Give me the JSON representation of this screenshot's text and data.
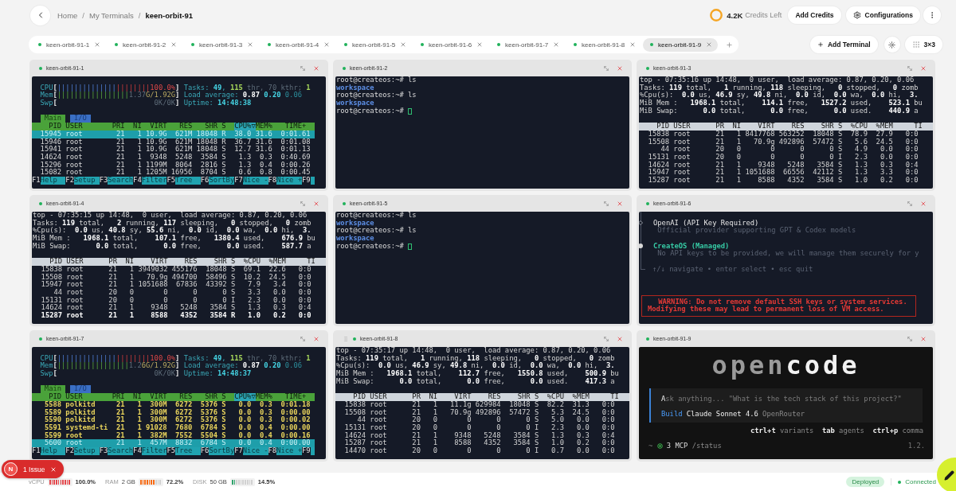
{
  "header": {
    "breadcrumb": {
      "items": [
        "Home",
        "My Terminals",
        "keen-orbit-91"
      ],
      "separator": "/"
    },
    "credits": {
      "amount": "4.2K",
      "label": "Credits Left"
    },
    "add_credits": "Add Credits",
    "configurations": "Configurations"
  },
  "tabs": [
    {
      "label": "keen-orbit-91-1",
      "selected": false
    },
    {
      "label": "keen-orbit-91-2",
      "selected": false
    },
    {
      "label": "keen-orbit-91-3",
      "selected": false
    },
    {
      "label": "keen-orbit-91-4",
      "selected": false
    },
    {
      "label": "keen-orbit-91-5",
      "selected": false
    },
    {
      "label": "keen-orbit-91-6",
      "selected": false
    },
    {
      "label": "keen-orbit-91-7",
      "selected": false
    },
    {
      "label": "keen-orbit-91-8",
      "selected": false
    },
    {
      "label": "keen-orbit-91-9",
      "selected": true
    }
  ],
  "toolbar": {
    "add_terminal": "Add Terminal",
    "layout": "3×3"
  },
  "terminals": [
    {
      "title": "keen-orbit-91-1",
      "kind": "htop",
      "hovered": false,
      "meters": [
        [
          {
            "kind": "label",
            "text": "CPU"
          },
          {
            "kind": "bracket",
            "text": "["
          },
          {
            "kind": "bar-blue",
            "text": "||||||||||||||"
          },
          {
            "kind": "bar-red",
            "text": "||||||||"
          },
          {
            "kind": "red",
            "text": "100.0%"
          },
          {
            "kind": "bracket",
            "text": "]"
          },
          {
            "kind": "label",
            "text": " Tasks: "
          },
          {
            "kind": "cyan-bold",
            "text": "49"
          },
          {
            "kind": "label",
            "text": ", "
          },
          {
            "kind": "green-bold",
            "text": "115"
          },
          {
            "kind": "dim",
            "text": " thr, 70 kthr; "
          },
          {
            "kind": "green-bold",
            "text": "1"
          }
        ],
        [
          {
            "kind": "label",
            "text": "Mem"
          },
          {
            "kind": "bracket",
            "text": "["
          },
          {
            "kind": "bar-green",
            "text": "|||||||||||||||||"
          },
          {
            "kind": "dim",
            "text": "1.37"
          },
          {
            "kind": "yellow",
            "text": "G/1.92G"
          },
          {
            "kind": "bracket",
            "text": "]"
          },
          {
            "kind": "label",
            "text": " Load average: "
          },
          {
            "kind": "white-bold",
            "text": "0.87"
          },
          {
            "kind": "cyan-bold",
            "text": " 0.20"
          },
          {
            "kind": "cyan-dim",
            "text": " 0.06"
          }
        ],
        [
          {
            "kind": "label",
            "text": "Swp"
          },
          {
            "kind": "bracket",
            "text": "["
          },
          {
            "kind": "dim",
            "text": "                       0K/0K"
          },
          {
            "kind": "bracket",
            "text": "]"
          },
          {
            "kind": "label",
            "text": " Uptime: "
          },
          {
            "kind": "cyan-bold",
            "text": "14:48:38"
          }
        ]
      ],
      "tabs": [
        {
          "label": "Main",
          "selected": true
        },
        {
          "label": "I/O",
          "selected": false
        }
      ],
      "columns": [
        {
          "text": "    PID USER       PRI  NI  VIRT   RES   SHR S  ",
          "selected": false
        },
        {
          "text": "CPU%▽",
          "selected": true
        },
        {
          "text": "MEM%   TIME+",
          "selected": false
        }
      ],
      "processes": [
        {
          "text": "  15945 root        21   1 10.9G  621M 18048 R  38.0 31.6  0:01.61",
          "selected": true,
          "marked": false
        },
        {
          "text": "  15946 root        21   1 10.9G  621M 18048 R  36.7 31.6  0:01.08",
          "selected": false,
          "marked": false
        },
        {
          "text": "  15941 root        21   1 10.9G  621M 18048 S  12.7 31.6  0:01.13",
          "selected": false,
          "marked": false
        },
        {
          "text": "  14624 root        21   1  9348  5248  3584 S   1.3  0.3  0:40.69",
          "selected": false,
          "marked": false
        },
        {
          "text": "  15296 root        21   1 1199M  8064  2816 S   1.3  0.4  0:00.26",
          "selected": false,
          "marked": false
        },
        {
          "text": "  15082 root        21   1 1205M 16956  8704 S   0.6  0.8  0:00.45",
          "selected": false,
          "marked": false
        }
      ],
      "function_keys": [
        {
          "key": "F1",
          "label": "Help"
        },
        {
          "key": "F2",
          "label": "Setup"
        },
        {
          "key": "F3",
          "label": "Search"
        },
        {
          "key": "F4",
          "label": "Filter"
        },
        {
          "key": "F5",
          "label": "Tree"
        },
        {
          "key": "F6",
          "label": "SortBy"
        },
        {
          "key": "F7",
          "label": "Nice -"
        },
        {
          "key": "F8",
          "label": "Nice +"
        },
        {
          "key": "F9"
        }
      ]
    },
    {
      "title": "keen-orbit-91-2",
      "kind": "shell",
      "hovered": false,
      "lines": [
        {
          "kind": "command",
          "text": "root@createos:~# ls"
        },
        {
          "kind": "output",
          "text": "workspace"
        },
        {
          "kind": "command",
          "text": "root@createos:~# ls"
        },
        {
          "kind": "output",
          "text": "workspace"
        },
        {
          "kind": "prompt",
          "text": "root@createos:~#"
        }
      ]
    },
    {
      "title": "keen-orbit-91-3",
      "kind": "top",
      "hovered": false,
      "summary": [
        "top - 07:35:16 up 14:48,  0 user,  load average: 0.87, 0.20, 0.06",
        "Tasks: **119** total,   **1** running, **118** sleeping,   **0** stopped,   **0** zomb",
        "%Cpu(s):  **0.0** us, **46.9** sy, **49.8** ni,  **0.0** id,  **0.0** wa,  **0.0** hi,  **3.**",
        "MiB Mem :   **1968.1** total,    **114.1** free,   **1527.2** used,    **523.1** bu",
        "MiB Swap:      **0.0** total,      **0.0** free,      **0.0** used.    **440.9** a"
      ],
      "columns": "    PID USER      PR  NI    VIRT    RES    SHR S  %CPU  %MEM     TI",
      "processes": [
        {
          "text": "  15838 root      21   1 8417768 563252  18048 S  78.9  27.9   0:0",
          "highlighted": false
        },
        {
          "text": "  15508 root      21   1   70.9g 492896  57472 S   5.6  24.5   0:0",
          "highlighted": false
        },
        {
          "text": "     44 root      20   0       0      0      0 S   4.9   0.0   0:0",
          "highlighted": false
        },
        {
          "text": "  15131 root      20   0       0      0      0 I   2.3   0.0   0:0",
          "highlighted": false
        },
        {
          "text": "  14624 root      21   1    9348   5248   3584 S   1.3   0.3   0:4",
          "highlighted": false
        },
        {
          "text": "  15947 root      21   1 1051688  66556  42112 S   1.3   3.3   0:0",
          "highlighted": false
        },
        {
          "text": "  15287 root      21   1    8588   4352   3584 S   1.0   0.2   0:0",
          "highlighted": false
        }
      ]
    },
    {
      "title": "keen-orbit-91-4",
      "kind": "top",
      "hovered": false,
      "summary": [
        "top - 07:35:15 up 14:48,  0 user,  load average: 0.87, 0.20, 0.06",
        "Tasks: **119** total,   **2** running, **117** sleeping,   **0** stopped,   **0** zomb",
        "%Cpu(s):  **0.0** us, **40.8** sy, **55.6** ni,  **0.0** id,  **0.0** wa,  **0.0** hi,  **3.**",
        "MiB Mem :   **1968.1** total,    **107.1** free,   **1380.4** used,    **676.9** bu",
        "MiB Swap:      **0.0** total,      **0.0** free,      **0.0** used.    **587.7** a"
      ],
      "columns": "    PID USER      PR  NI    VIRT    RES    SHR S  %CPU  %MEM     TI",
      "processes": [
        {
          "text": "  15838 root      21   1 3949032 455176  18048 S  69.1  22.6   0:0",
          "highlighted": false
        },
        {
          "text": "  15508 root      21   1   70.9g 494700  58496 S  10.2  24.5   0:0",
          "highlighted": false
        },
        {
          "text": "  15947 root      21   1 1051688  67836  43392 S   7.9   3.4   0:0",
          "highlighted": false
        },
        {
          "text": "     44 root      20   0       0      0      0 S   3.3   0.0   0:0",
          "highlighted": false
        },
        {
          "text": "  15131 root      20   0       0      0      0 I   2.3   0.0   0:0",
          "highlighted": false
        },
        {
          "text": "  14624 root      21   1    9348   5248   3584 S   1.3   0.3   0:4",
          "highlighted": false
        },
        {
          "text": "  15287 root      21   1    8588   4352   3584 R   1.0   0.2   0:0",
          "highlighted": true
        }
      ]
    },
    {
      "title": "keen-orbit-91-5",
      "kind": "shell",
      "hovered": false,
      "lines": [
        {
          "kind": "command",
          "text": "root@createos:~# ls"
        },
        {
          "kind": "output",
          "text": "workspace"
        },
        {
          "kind": "command",
          "text": "root@createos:~# ls"
        },
        {
          "kind": "output",
          "text": "workspace"
        },
        {
          "kind": "prompt",
          "text": "root@createos:~#"
        }
      ]
    },
    {
      "title": "keen-orbit-91-6",
      "kind": "provider-select",
      "hovered": false,
      "options": [
        {
          "label": "OpenAI (API Key Required)",
          "description": "Official provider supporting GPT & Codex models",
          "selected": false
        },
        {
          "label": "CreateOS (Managed)",
          "description": "No API keys to be provided, we will manage them securely for y",
          "selected": true
        }
      ],
      "hint": "↑/↓ navigate • enter select • esc quit",
      "warning": [
        "WARNING: Do not remove default SSH keys or system services.",
        "Modifying these may lead to permanent loss of VM access."
      ]
    },
    {
      "title": "keen-orbit-91-7",
      "kind": "htop",
      "hovered": false,
      "meters": [
        [
          {
            "kind": "label",
            "text": "CPU"
          },
          {
            "kind": "bracket",
            "text": "["
          },
          {
            "kind": "bar-blue",
            "text": "||||||||||||||"
          },
          {
            "kind": "bar-red",
            "text": "||||||||"
          },
          {
            "kind": "red",
            "text": "100.0%"
          },
          {
            "kind": "bracket",
            "text": "]"
          },
          {
            "kind": "label",
            "text": " Tasks: "
          },
          {
            "kind": "cyan-bold",
            "text": "49"
          },
          {
            "kind": "label",
            "text": ", "
          },
          {
            "kind": "green-bold",
            "text": "115"
          },
          {
            "kind": "dim",
            "text": " thr, 70 kthr; "
          },
          {
            "kind": "green-bold",
            "text": "1"
          }
        ],
        [
          {
            "kind": "label",
            "text": "Mem"
          },
          {
            "kind": "bracket",
            "text": "["
          },
          {
            "kind": "bar-green",
            "text": "|||||||||||||||||"
          },
          {
            "kind": "dim",
            "text": "1.2"
          },
          {
            "kind": "yellow",
            "text": "6G/1.92G"
          },
          {
            "kind": "bracket",
            "text": "]"
          },
          {
            "kind": "label",
            "text": " Load average: "
          },
          {
            "kind": "white-bold",
            "text": "0.87"
          },
          {
            "kind": "cyan-bold",
            "text": " 0.20"
          },
          {
            "kind": "cyan-dim",
            "text": " 0.06"
          }
        ],
        [
          {
            "kind": "label",
            "text": "Swp"
          },
          {
            "kind": "bracket",
            "text": "["
          },
          {
            "kind": "dim",
            "text": "                       0K/0K"
          },
          {
            "kind": "bracket",
            "text": "]"
          },
          {
            "kind": "label",
            "text": " Uptime: "
          },
          {
            "kind": "cyan-bold",
            "text": "14:48:37"
          }
        ]
      ],
      "tabs": [
        {
          "label": "Main",
          "selected": true
        },
        {
          "label": "I/O",
          "selected": false
        }
      ],
      "columns": [
        {
          "text": "    PID USER       PRI  NI  VIRT   RES   SHR S  ",
          "selected": false
        },
        {
          "text": "CPU%▽",
          "selected": true
        },
        {
          "text": "MEM%   TIME+",
          "selected": false
        }
      ],
      "processes": [
        {
          "text": "   5588 polkitd     21   1  300M  6272  5376 S   0.0  0.3  0:01.18",
          "selected": false,
          "marked": true
        },
        {
          "text": "   5589 polkitd     21   1  300M  6272  5376 S   0.0  0.3  0:00.00",
          "selected": false,
          "marked": true
        },
        {
          "text": "   5590 polkitd     21   1  300M  6272  5376 S   0.0  0.3  0:00.02",
          "selected": false,
          "marked": true
        },
        {
          "text": "   5591 systemd-ti  21   1 91028  7680  6784 S   0.0  0.4  0:00.00",
          "selected": false,
          "marked": true
        },
        {
          "text": "   5599 root        21   1  382M  7552  5504 S   0.0  0.4  0:00.16",
          "selected": false,
          "marked": true
        },
        {
          "text": "   5600 root        21   1  457M  8832  6784 S   0.0  0.4  0:00.00",
          "selected": true,
          "marked": false
        }
      ],
      "function_keys": [
        {
          "key": "F1",
          "label": "Help"
        },
        {
          "key": "F2",
          "label": "Setup"
        },
        {
          "key": "F3",
          "label": "Search"
        },
        {
          "key": "F4",
          "label": "Filter"
        },
        {
          "key": "F5",
          "label": "Tree"
        },
        {
          "key": "F6",
          "label": "SortBy"
        },
        {
          "key": "F7",
          "label": "Nice -"
        },
        {
          "key": "F8",
          "label": "Nice +"
        },
        {
          "key": "F9"
        }
      ]
    },
    {
      "title": "keen-orbit-91-8",
      "kind": "top",
      "hovered": true,
      "summary": [
        "top - 07:35:17 up 14:48,  0 user,  load average: 0.87, 0.20, 0.06",
        "Tasks: **119** total,   **1** running, **118** sleeping,   **0** stopped,   **0** zomb",
        "%Cpu(s):  **0.0** us, **46.9** sy, **49.8** ni,  **0.0** id,  **0.0** wa,  **0.0** hi,  **3.**",
        "MiB Mem :   **1968.1** total,    **112.7** free,   **1550.8** used,    **500.9** bu",
        "MiB Swap:      **0.0** total,      **0.0** free,      **0.0** used.    **417.3** a"
      ],
      "columns": "    PID USER      PR  NI    VIRT    RES    SHR S  %CPU  %MEM     TI",
      "processes": [
        {
          "text": "  15838 root      21   1   11.1g 629984  18048 S  82.2  31.3   0:0",
          "highlighted": false
        },
        {
          "text": "  15508 root      21   1   70.9g 492896  57472 S   5.3  24.5   0:0",
          "highlighted": false
        },
        {
          "text": "     44 root      20   0       0      0      0 S   5.0   0.0   0:0",
          "highlighted": false
        },
        {
          "text": "  15131 root      20   0       0      0      0 I   2.3   0.0   0:0",
          "highlighted": false
        },
        {
          "text": "  14624 root      21   1    9348   5248   3584 S   1.3   0.3   0:4",
          "highlighted": false
        },
        {
          "text": "  15287 root      21   1    8588   4352   3584 S   1.0   0.2   0:0",
          "highlighted": false
        },
        {
          "text": "  14470 root      20   0       0      0      0 I   0.7   0.0   0:0",
          "highlighted": false
        }
      ]
    },
    {
      "title": "keen-orbit-91-9",
      "kind": "opencode",
      "hovered": false,
      "logo": {
        "dim": "open",
        "bright": "code"
      },
      "prompt": {
        "placeholder": "Ask anything... \"What is the tech stack of this project?\"",
        "agent": "Build",
        "model": "Claude Sonnet 4.6",
        "provider": "OpenRouter"
      },
      "shortcuts": [
        {
          "key": "ctrl+t",
          "label": "variants"
        },
        {
          "key": "tab",
          "label": "agents"
        },
        {
          "key": "ctrl+p",
          "label": "comma"
        }
      ],
      "status": {
        "cwd": "~",
        "mcp": "3 MCP",
        "command": "/status",
        "version": "1.2."
      }
    }
  ],
  "status_bar": {
    "metrics": [
      {
        "label": "vCPU",
        "level": 1,
        "reading": "100.0%",
        "color": "#e5484d"
      },
      {
        "label": "RAM",
        "value": "2 GB",
        "level": 0.722,
        "reading": "72.2%",
        "color": "#f76b15"
      },
      {
        "label": "DISK",
        "value": "50 GB",
        "level": 0.145,
        "reading": "14.5%",
        "color": "#30a46c"
      }
    ],
    "deployment": "Deployed",
    "connection": "Connected"
  },
  "dev_overlay": {
    "logo": "N",
    "label": "1 Issue"
  }
}
